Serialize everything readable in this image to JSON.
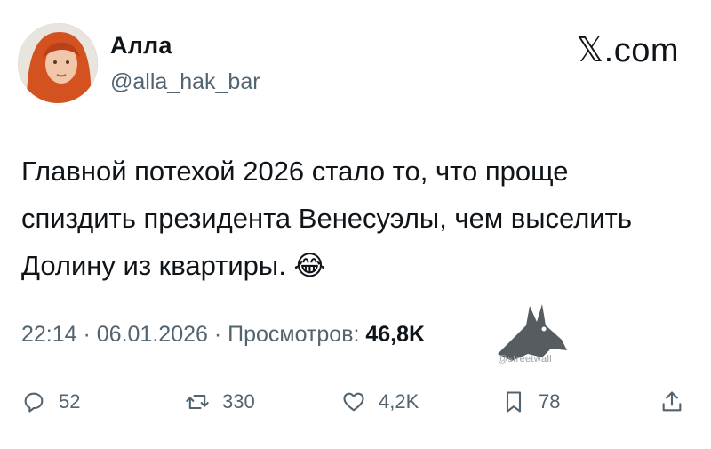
{
  "user": {
    "name": "Алла",
    "handle": "@alla_hak_bar"
  },
  "brand": "𝕏.com",
  "tweet": {
    "text": "Главной потехой 2026 стало то, что проще спиздить президента Венесуэлы, чем выселить Долину из квартиры. 😂"
  },
  "meta": {
    "time_date": "22:14 · 06.01.2026 · Просмотров: ",
    "views": "46,8K"
  },
  "watermark": {
    "text": "@streetwall"
  },
  "actions": {
    "replies": "52",
    "reposts": "330",
    "likes": "4,2K",
    "bookmarks": "78"
  },
  "icons": {
    "reply": "comment-icon",
    "repost": "repost-icon",
    "like": "heart-icon",
    "bookmark": "bookmark-icon",
    "share": "share-icon"
  },
  "colors": {
    "text": "#0f1419",
    "secondary": "#536471"
  }
}
